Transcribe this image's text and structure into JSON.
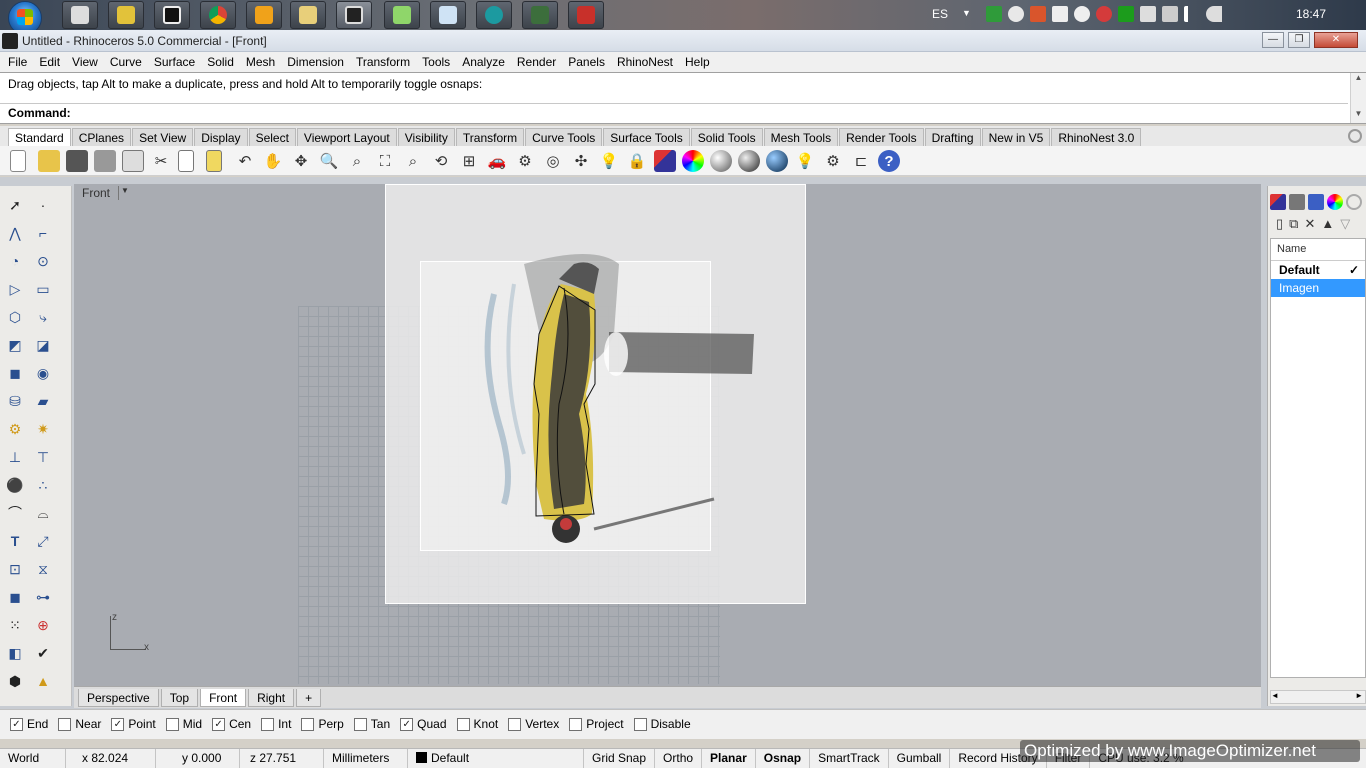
{
  "taskbar": {
    "language": "ES",
    "clock": "18:47"
  },
  "window": {
    "title": "Untitled - Rhinoceros 5.0 Commercial - [Front]",
    "minimize": "—",
    "maximize": "❐",
    "close": "✕"
  },
  "menu": [
    "File",
    "Edit",
    "View",
    "Curve",
    "Surface",
    "Solid",
    "Mesh",
    "Dimension",
    "Transform",
    "Tools",
    "Analyze",
    "Render",
    "Panels",
    "RhinoNest",
    "Help"
  ],
  "command": {
    "history": "Drag objects, tap Alt to make a duplicate, press and hold Alt to temporarily toggle osnaps:",
    "prompt": "Command:"
  },
  "toolbar_tabs": [
    "Standard",
    "CPlanes",
    "Set View",
    "Display",
    "Select",
    "Viewport Layout",
    "Visibility",
    "Transform",
    "Curve Tools",
    "Surface Tools",
    "Solid Tools",
    "Mesh Tools",
    "Render Tools",
    "Drafting",
    "New in V5",
    "RhinoNest 3.0"
  ],
  "active_toolbar_tab": "Standard",
  "viewport": {
    "label": "Front",
    "axis_z": "z",
    "axis_x": "x"
  },
  "view_tabs": [
    "Perspective",
    "Top",
    "Front",
    "Right"
  ],
  "active_view_tab": "Front",
  "view_tab_add": "+",
  "layers": {
    "header": "Name",
    "rows": [
      {
        "name": "Default",
        "current": true,
        "check": "✓"
      },
      {
        "name": "Imagen",
        "current": false,
        "selected": true
      }
    ]
  },
  "osnaps": [
    {
      "label": "End",
      "checked": true
    },
    {
      "label": "Near",
      "checked": false
    },
    {
      "label": "Point",
      "checked": true
    },
    {
      "label": "Mid",
      "checked": false
    },
    {
      "label": "Cen",
      "checked": true
    },
    {
      "label": "Int",
      "checked": false
    },
    {
      "label": "Perp",
      "checked": false
    },
    {
      "label": "Tan",
      "checked": false
    },
    {
      "label": "Quad",
      "checked": true
    },
    {
      "label": "Knot",
      "checked": false
    },
    {
      "label": "Vertex",
      "checked": false
    },
    {
      "label": "Project",
      "checked": false
    },
    {
      "label": "Disable",
      "checked": false
    }
  ],
  "status": {
    "cplane": "World",
    "x": "x 82.024",
    "y": "y 0.000",
    "z": "z 27.751",
    "units": "Millimeters",
    "layer": "Default",
    "grid_snap": "Grid Snap",
    "ortho": "Ortho",
    "planar": "Planar",
    "osnap": "Osnap",
    "smarttrack": "SmartTrack",
    "gumball": "Gumball",
    "record_history": "Record History",
    "filter": "Filter",
    "cpu": "CPU use: 3.2 %"
  },
  "watermark": "Optimized by www.ImageOptimizer.net",
  "colors": {
    "selection": "#3399ff",
    "viewport_bg": "#a9acb2",
    "knife_yellow": "#d9c24a"
  }
}
